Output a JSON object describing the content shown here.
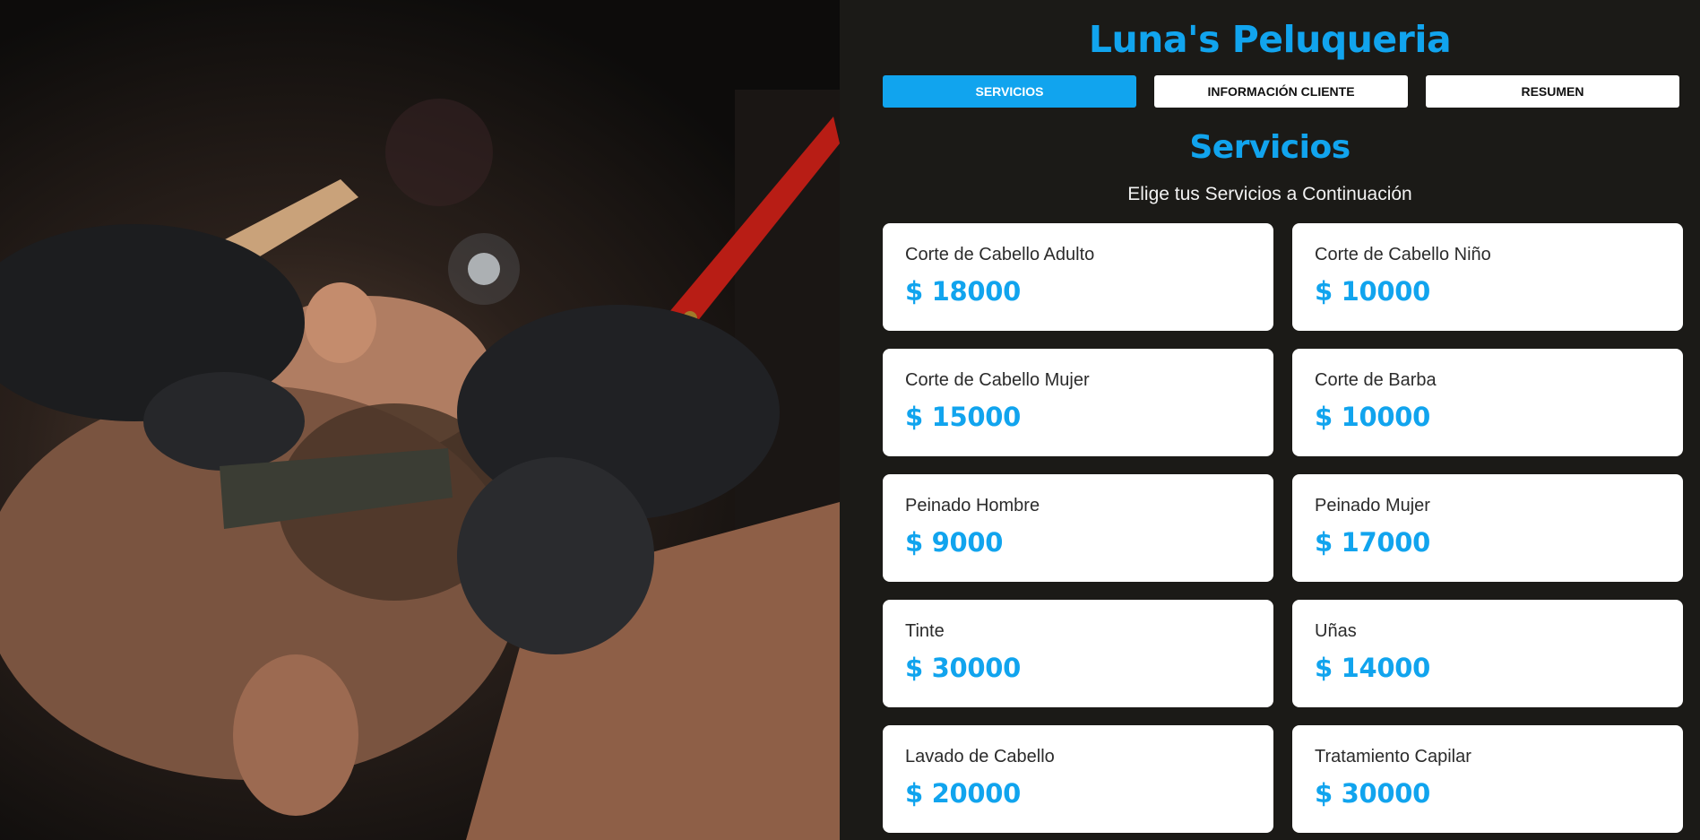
{
  "app": {
    "title": "Luna's Peluqueria"
  },
  "tabs": [
    {
      "label": "Servicios",
      "active": true
    },
    {
      "label": "Información Cliente",
      "active": false
    },
    {
      "label": "Resumen",
      "active": false
    }
  ],
  "section": {
    "title": "Servicios",
    "subtitle": "Elige tus Servicios a Continuación"
  },
  "services": [
    {
      "name": "Corte de Cabello Adulto",
      "price": "$ 18000"
    },
    {
      "name": "Corte de Cabello Niño",
      "price": "$ 10000"
    },
    {
      "name": "Corte de Cabello Mujer",
      "price": "$ 15000"
    },
    {
      "name": "Corte de Barba",
      "price": "$ 10000"
    },
    {
      "name": "Peinado Hombre",
      "price": "$ 9000"
    },
    {
      "name": "Peinado Mujer",
      "price": "$ 17000"
    },
    {
      "name": "Tinte",
      "price": "$ 30000"
    },
    {
      "name": "Uñas",
      "price": "$ 14000"
    },
    {
      "name": "Lavado de Cabello",
      "price": "$ 20000"
    },
    {
      "name": "Tratamiento Capilar",
      "price": "$ 30000"
    }
  ],
  "colors": {
    "accent": "#11a4ee",
    "background": "#1b1a17",
    "card": "#ffffff"
  }
}
